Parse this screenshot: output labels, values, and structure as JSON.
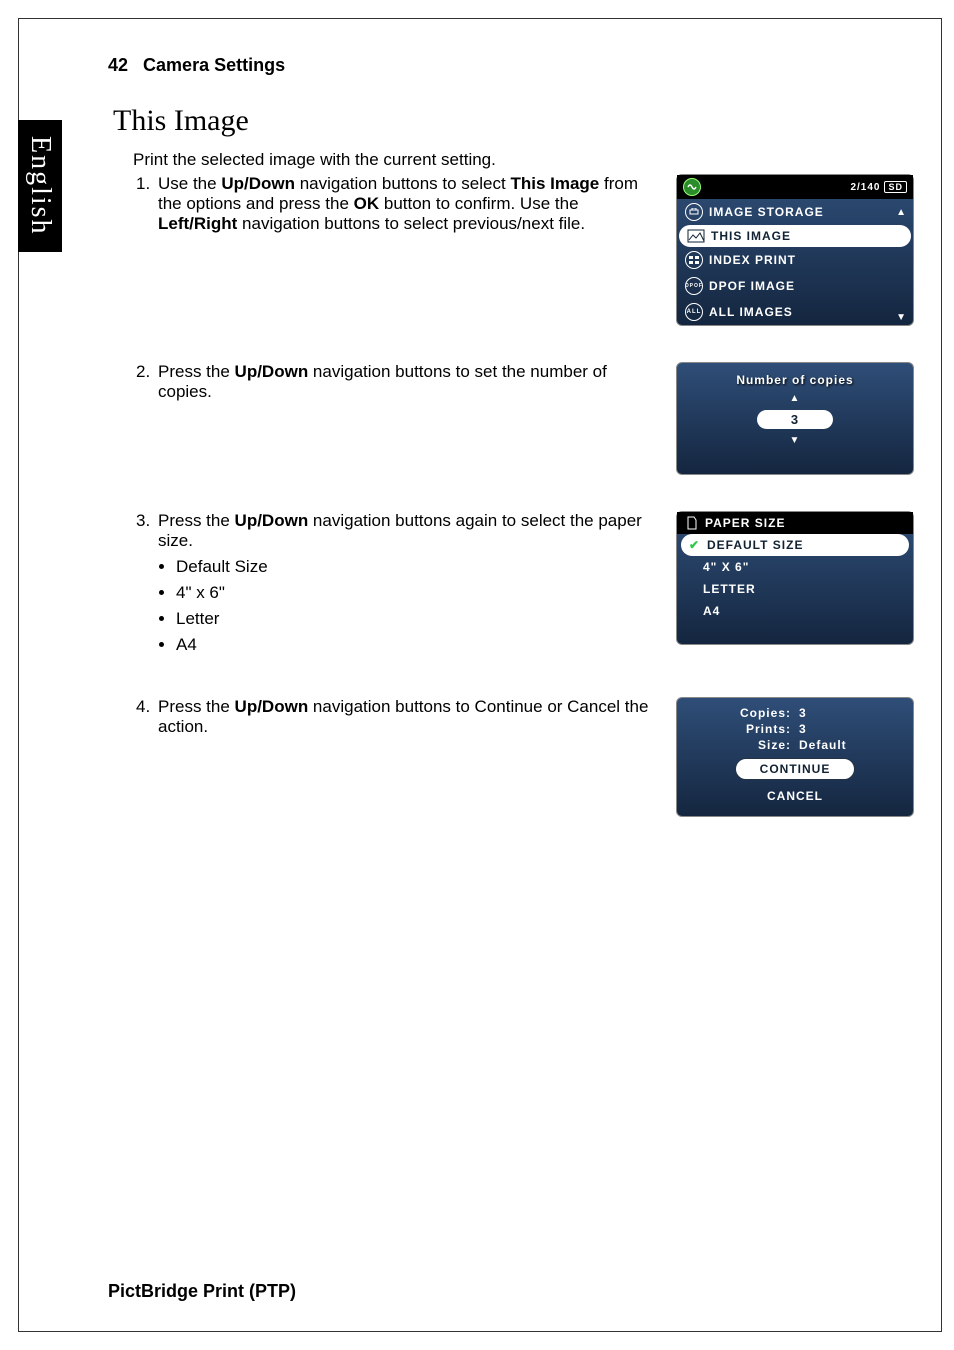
{
  "header": {
    "page_number": "42",
    "chapter": "Camera Settings"
  },
  "language_tab": "English",
  "section": {
    "title": "This Image",
    "intro": "Print the selected image with the current setting."
  },
  "steps": {
    "s1": {
      "num": "1.",
      "text_pre": "Use the ",
      "b1": "Up/Down",
      "text_mid1": " navigation buttons to select ",
      "b2": "This Image",
      "text_mid2": " from the options and press the ",
      "b3": "OK",
      "text_mid3": " button to confirm. Use the ",
      "b4": "Left/Right",
      "text_post": " navigation buttons to select previous/next file."
    },
    "s2": {
      "num": "2.",
      "text_pre": "Press the ",
      "b1": "Up/Down",
      "text_post": " navigation buttons to set the number of copies."
    },
    "s3": {
      "num": "3.",
      "text_pre": "Press the ",
      "b1": "Up/Down",
      "text_post": " navigation buttons again to select the paper size.",
      "bullets": [
        "Default Size",
        "4\" x 6\"",
        "Letter",
        "A4"
      ]
    },
    "s4": {
      "num": "4.",
      "text_pre": "Press the ",
      "b1": "Up/Down",
      "text_post": " navigation buttons to Continue or Cancel the action."
    }
  },
  "lcd1": {
    "counter": "2/140",
    "sd": "SD",
    "items": [
      "IMAGE STORAGE",
      "THIS IMAGE",
      "INDEX PRINT",
      "DPOF IMAGE",
      "ALL IMAGES"
    ]
  },
  "lcd2": {
    "header": "Number of copies",
    "value": "3"
  },
  "lcd3": {
    "header": "PAPER SIZE",
    "items": [
      "DEFAULT SIZE",
      "4\" X 6\"",
      "LETTER",
      "A4"
    ]
  },
  "lcd4": {
    "copies_k": "Copies:",
    "copies_v": "3",
    "prints_k": "Prints:",
    "prints_v": "3",
    "size_k": "Size:",
    "size_v": "Default",
    "continue": "CONTINUE",
    "cancel": "CANCEL"
  },
  "footer": "PictBridge Print (PTP)"
}
